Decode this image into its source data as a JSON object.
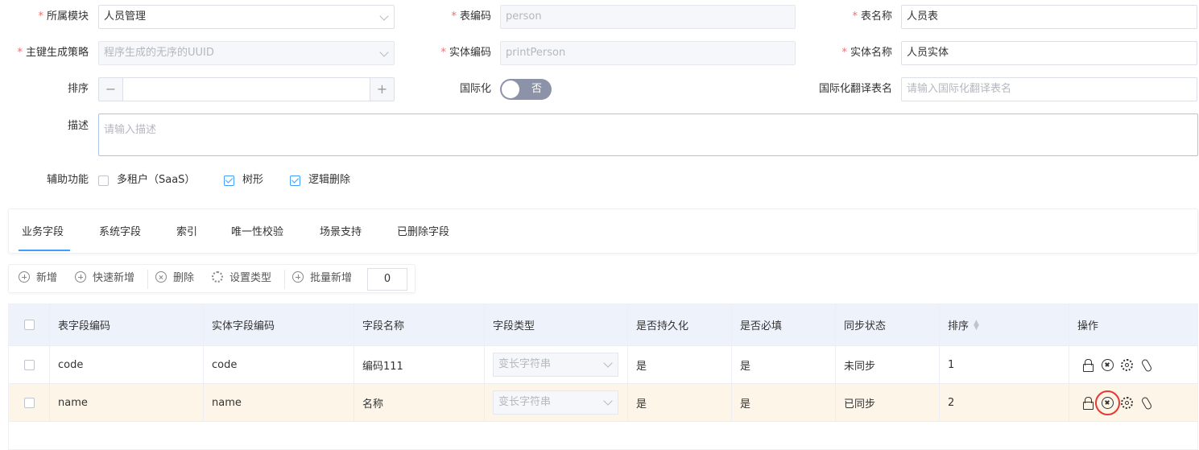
{
  "form": {
    "module_label": "所属模块",
    "module_value": "人员管理",
    "table_code_label": "表编码",
    "table_code_value": "person",
    "table_name_label": "表名称",
    "table_name_value": "人员表",
    "pk_label": "主键生成策略",
    "pk_value": "程序生成的无序的UUID",
    "entity_code_label": "实体编码",
    "entity_code_value": "printPerson",
    "entity_name_label": "实体名称",
    "entity_name_value": "人员实体",
    "sort_label": "排序",
    "sort_minus": "−",
    "sort_plus": "+",
    "i18n_label": "国际化",
    "i18n_toggle": "否",
    "i18n_table_label": "国际化翻译表名",
    "i18n_table_placeholder": "请输入国际化翻译表名",
    "desc_label": "描述",
    "desc_placeholder": "请输入描述",
    "aux_label": "辅助功能",
    "aux_options": [
      {
        "label": "多租户（SaaS）",
        "checked": false
      },
      {
        "label": "树形",
        "checked": true
      },
      {
        "label": "逻辑删除",
        "checked": true
      }
    ]
  },
  "tabs": [
    "业务字段",
    "系统字段",
    "索引",
    "唯一性校验",
    "场景支持",
    "已删除字段"
  ],
  "toolbar": {
    "add": "新增",
    "quick_add": "快速新增",
    "delete": "删除",
    "set_type": "设置类型",
    "batch_add": "批量新增",
    "batch_count": "0"
  },
  "table": {
    "headers": [
      "表字段编码",
      "实体字段编码",
      "字段名称",
      "字段类型",
      "是否持久化",
      "是否必填",
      "同步状态",
      "排序",
      "操作"
    ],
    "rows": [
      {
        "table_code": "code",
        "entity_code": "code",
        "name": "编码111",
        "type": "变长字符串",
        "persist": "是",
        "required": "是",
        "sync": "未同步",
        "order": "1"
      },
      {
        "table_code": "name",
        "entity_code": "name",
        "name": "名称",
        "type": "变长字符串",
        "persist": "是",
        "required": "是",
        "sync": "已同步",
        "order": "2"
      }
    ]
  },
  "colors": {
    "accent": "#409eff",
    "required": "#f56c6c",
    "highlight_row": "#fdf6e8",
    "header_bg": "#eef3fb",
    "toggle_off": "#8c93a8",
    "highlight_box": "#e53935"
  }
}
